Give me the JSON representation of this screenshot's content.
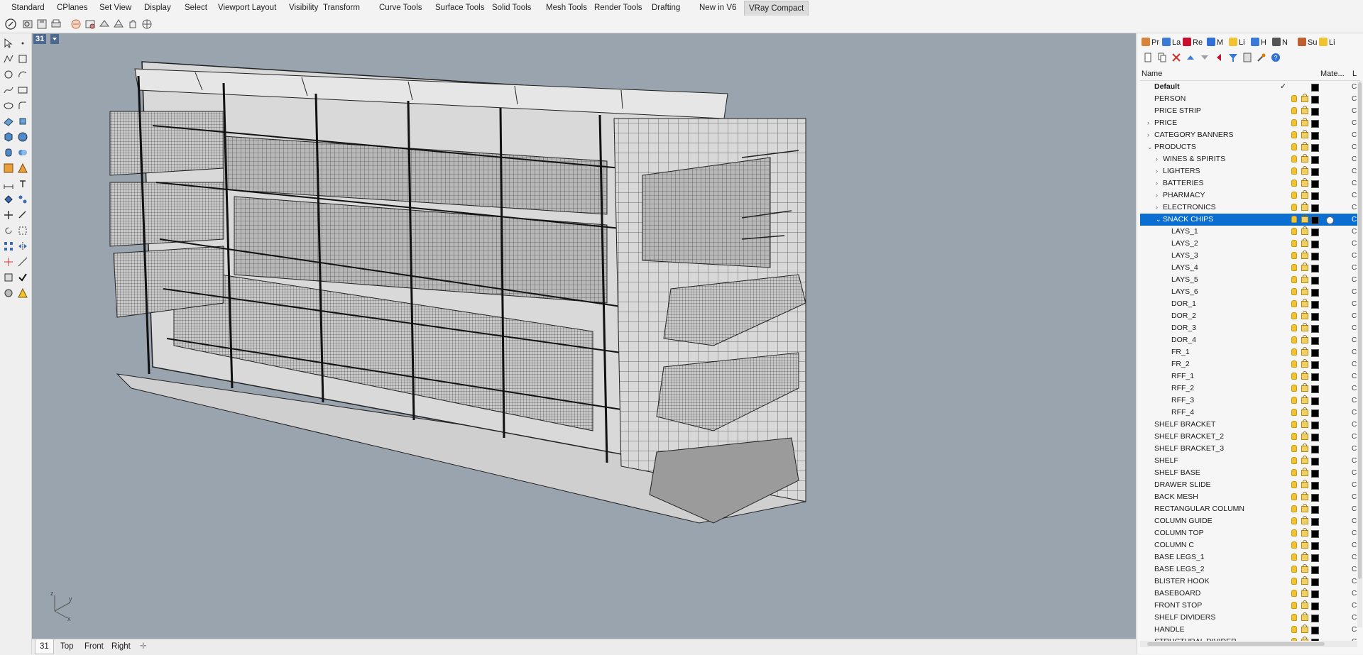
{
  "ribbon_tabs": [
    "Standard",
    "CPlanes",
    "Set View",
    "Display",
    "Select",
    "Viewport Layout",
    "Visibility",
    "Transform",
    "Curve Tools",
    "Surface Tools",
    "Solid Tools",
    "Mesh Tools",
    "Render Tools",
    "Drafting",
    "New in V6",
    "VRay Compact"
  ],
  "active_ribbon_tab": "VRay Compact",
  "viewport": {
    "title": "31",
    "axes": {
      "z": "z",
      "y": "y",
      "x": "x"
    },
    "tabs": [
      "31",
      "Top",
      "Front",
      "Right"
    ],
    "active_tab": "31",
    "background_color": "#9aa4af"
  },
  "panel": {
    "tabs": [
      "Pr",
      "La",
      "Re",
      "M",
      "Li",
      "H",
      "N",
      "Su",
      "Li"
    ],
    "columns": {
      "name": "Name",
      "material": "Mate...",
      "linetype": "L"
    },
    "layers": [
      {
        "name": "Default",
        "level": 0,
        "bold": true,
        "current": true,
        "check": "✓",
        "expand": ""
      },
      {
        "name": "PERSON",
        "level": 0,
        "expand": ""
      },
      {
        "name": "PRICE STRIP",
        "level": 0,
        "expand": ""
      },
      {
        "name": "PRICE",
        "level": 0,
        "expand": "›"
      },
      {
        "name": "CATEGORY BANNERS",
        "level": 0,
        "expand": "›"
      },
      {
        "name": "PRODUCTS",
        "level": 0,
        "expand": "⌄"
      },
      {
        "name": "WINES & SPIRITS",
        "level": 1,
        "expand": "›"
      },
      {
        "name": "LIGHTERS",
        "level": 1,
        "expand": "›"
      },
      {
        "name": "BATTERIES",
        "level": 1,
        "expand": "›"
      },
      {
        "name": "PHARMACY",
        "level": 1,
        "expand": "›"
      },
      {
        "name": "ELECTRONICS",
        "level": 1,
        "expand": "›"
      },
      {
        "name": "SNACK CHIPS",
        "level": 1,
        "expand": "⌄",
        "selected": true
      },
      {
        "name": "LAYS_1",
        "level": 2,
        "expand": ""
      },
      {
        "name": "LAYS_2",
        "level": 2,
        "expand": ""
      },
      {
        "name": "LAYS_3",
        "level": 2,
        "expand": ""
      },
      {
        "name": "LAYS_4",
        "level": 2,
        "expand": ""
      },
      {
        "name": "LAYS_5",
        "level": 2,
        "expand": ""
      },
      {
        "name": "LAYS_6",
        "level": 2,
        "expand": ""
      },
      {
        "name": "DOR_1",
        "level": 2,
        "expand": ""
      },
      {
        "name": "DOR_2",
        "level": 2,
        "expand": ""
      },
      {
        "name": "DOR_3",
        "level": 2,
        "expand": ""
      },
      {
        "name": "DOR_4",
        "level": 2,
        "expand": ""
      },
      {
        "name": "FR_1",
        "level": 2,
        "expand": ""
      },
      {
        "name": "FR_2",
        "level": 2,
        "expand": ""
      },
      {
        "name": "RFF_1",
        "level": 2,
        "expand": ""
      },
      {
        "name": "RFF_2",
        "level": 2,
        "expand": ""
      },
      {
        "name": "RFF_3",
        "level": 2,
        "expand": ""
      },
      {
        "name": "RFF_4",
        "level": 2,
        "expand": ""
      },
      {
        "name": "SHELF BRACKET",
        "level": 0,
        "expand": ""
      },
      {
        "name": "SHELF BRACKET_2",
        "level": 0,
        "expand": ""
      },
      {
        "name": "SHELF BRACKET_3",
        "level": 0,
        "expand": ""
      },
      {
        "name": "SHELF",
        "level": 0,
        "expand": ""
      },
      {
        "name": "SHELF BASE",
        "level": 0,
        "expand": ""
      },
      {
        "name": "DRAWER SLIDE",
        "level": 0,
        "expand": ""
      },
      {
        "name": "BACK MESH",
        "level": 0,
        "expand": ""
      },
      {
        "name": "RECTANGULAR COLUMN",
        "level": 0,
        "expand": ""
      },
      {
        "name": "COLUMN GUIDE",
        "level": 0,
        "expand": ""
      },
      {
        "name": "COLUMN TOP",
        "level": 0,
        "expand": ""
      },
      {
        "name": "COLUMN C",
        "level": 0,
        "expand": ""
      },
      {
        "name": "BASE LEGS_1",
        "level": 0,
        "expand": ""
      },
      {
        "name": "BASE LEGS_2",
        "level": 0,
        "expand": ""
      },
      {
        "name": "BLISTER HOOK",
        "level": 0,
        "expand": ""
      },
      {
        "name": "BASEBOARD",
        "level": 0,
        "expand": ""
      },
      {
        "name": "FRONT STOP",
        "level": 0,
        "expand": ""
      },
      {
        "name": "SHELF DIVIDERS",
        "level": 0,
        "expand": ""
      },
      {
        "name": "HANDLE",
        "level": 0,
        "expand": ""
      },
      {
        "name": "STRUCTURAL DIVIDER",
        "level": 0,
        "expand": ""
      }
    ]
  },
  "colors": {
    "selection": "#0b6fd1",
    "viewport_title": "#4a6890",
    "layer_color": "#000000"
  }
}
